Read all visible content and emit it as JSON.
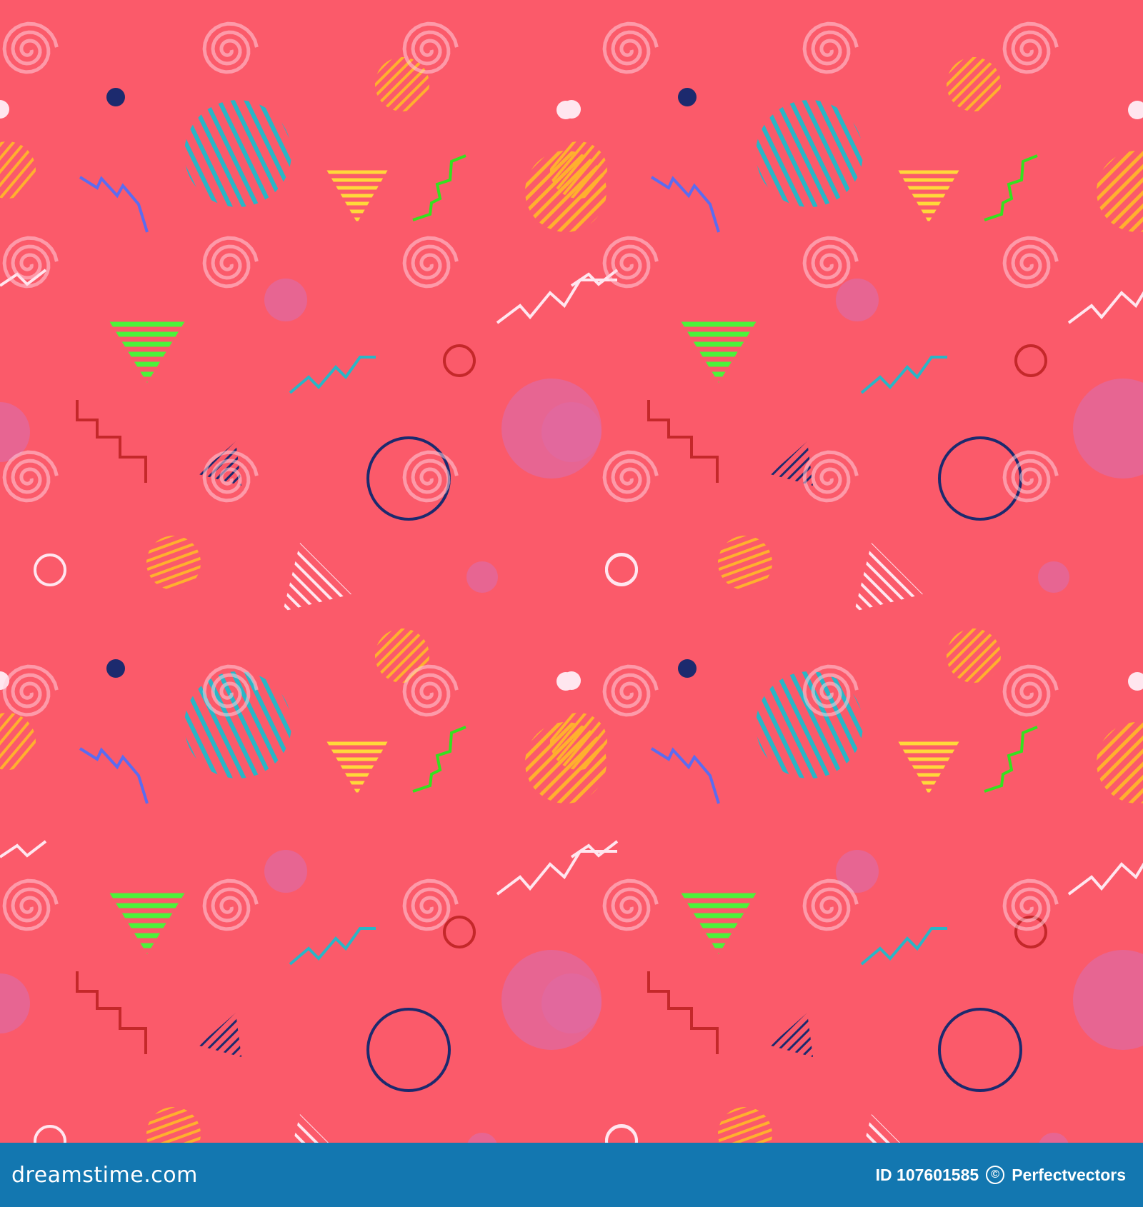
{
  "image": {
    "background_color": "#fb5a6a",
    "footer_color": "#1377b0",
    "shapes": [
      "striped-circle",
      "striped-triangle",
      "zigzag",
      "ring",
      "solid-dot",
      "spiral-watermark"
    ],
    "palette": {
      "teal": "#29b6c6",
      "orange": "#ffb02e",
      "yellow": "#ffd83a",
      "green": "#4cf33a",
      "lime": "#34e21f",
      "blue": "#5b6cf0",
      "navy": "#1c2a6e",
      "red": "#c4282a",
      "white": "#ffe6ef",
      "mauve": "#e06aa0"
    }
  },
  "footer": {
    "brand": "dreamstime.com",
    "id_label": "ID 107601585",
    "copyright_symbol": "©",
    "author": "Perfectvectors"
  }
}
